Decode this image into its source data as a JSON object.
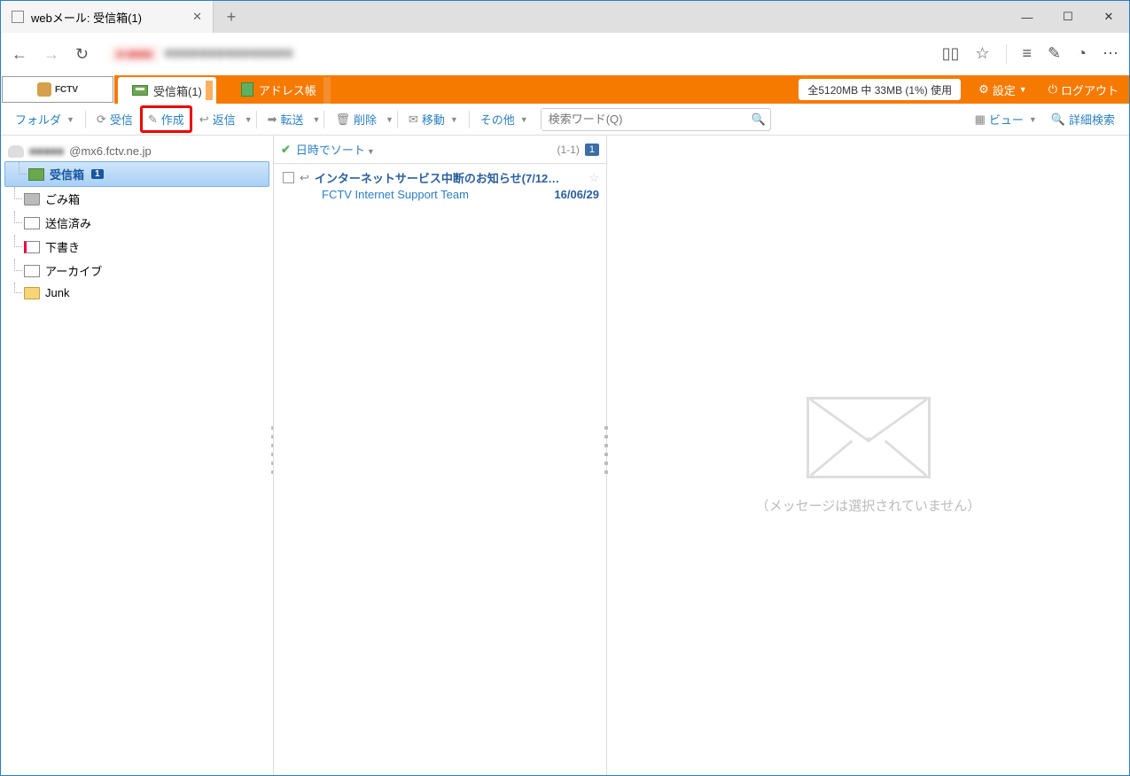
{
  "browser": {
    "tab_title": "webメール: 受信箱(1)"
  },
  "header": {
    "logo_text": "FCTV",
    "tab_inbox": "受信箱(1)",
    "tab_addressbook": "アドレス帳",
    "storage": "全5120MB 中 33MB (1%) 使用",
    "settings": "設定",
    "logout": "ログアウト"
  },
  "toolbar": {
    "folder": "フォルダ",
    "receive": "受信",
    "compose": "作成",
    "reply": "返信",
    "forward": "転送",
    "delete": "削除",
    "move": "移動",
    "other": "その他",
    "search_placeholder": "検索ワード(Q)",
    "view": "ビュー",
    "adv_search": "詳細検索"
  },
  "sidebar": {
    "account": "@mx6.fctv.ne.jp",
    "folders": {
      "inbox": "受信箱",
      "inbox_count": "1",
      "trash": "ごみ箱",
      "sent": "送信済み",
      "drafts": "下書き",
      "archive": "アーカイブ",
      "junk": "Junk"
    }
  },
  "msglist": {
    "sort_label": "日時でソート",
    "range": "(1-1)",
    "page": "1",
    "messages": [
      {
        "subject": "インターネットサービス中断のお知らせ(7/12…",
        "from": "FCTV Internet Support Team",
        "date": "16/06/29"
      }
    ]
  },
  "preview": {
    "empty_text": "（メッセージは選択されていません）"
  }
}
